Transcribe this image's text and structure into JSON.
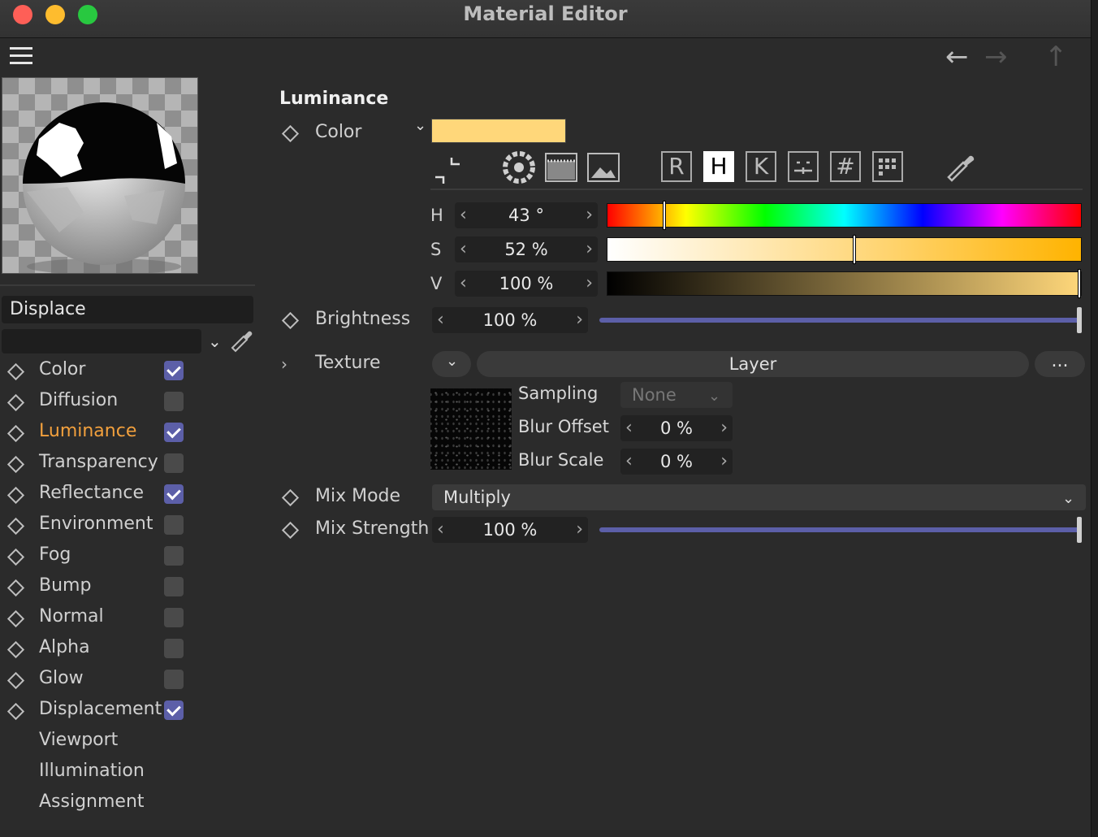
{
  "window": {
    "title": "Material Editor"
  },
  "toolbar": {
    "back_icon": "arrow-left-icon",
    "forward_icon": "arrow-right-icon",
    "up_icon": "arrow-up-icon"
  },
  "material": {
    "name": "Displace",
    "filter_value": ""
  },
  "channels": [
    {
      "label": "Color",
      "checked": true,
      "has_checkbox": true,
      "active": false
    },
    {
      "label": "Diffusion",
      "checked": false,
      "has_checkbox": true,
      "active": false
    },
    {
      "label": "Luminance",
      "checked": true,
      "has_checkbox": true,
      "active": true
    },
    {
      "label": "Transparency",
      "checked": false,
      "has_checkbox": true,
      "active": false
    },
    {
      "label": "Reflectance",
      "checked": true,
      "has_checkbox": true,
      "active": false
    },
    {
      "label": "Environment",
      "checked": false,
      "has_checkbox": true,
      "active": false
    },
    {
      "label": "Fog",
      "checked": false,
      "has_checkbox": true,
      "active": false
    },
    {
      "label": "Bump",
      "checked": false,
      "has_checkbox": true,
      "active": false
    },
    {
      "label": "Normal",
      "checked": false,
      "has_checkbox": true,
      "active": false
    },
    {
      "label": "Alpha",
      "checked": false,
      "has_checkbox": true,
      "active": false
    },
    {
      "label": "Glow",
      "checked": false,
      "has_checkbox": true,
      "active": false
    },
    {
      "label": "Displacement",
      "checked": true,
      "has_checkbox": true,
      "active": false
    },
    {
      "label": "Viewport",
      "has_checkbox": false,
      "active": false
    },
    {
      "label": "Illumination",
      "has_checkbox": false,
      "active": false
    },
    {
      "label": "Assignment",
      "has_checkbox": false,
      "active": false
    }
  ],
  "luminance": {
    "section_title": "Luminance",
    "color_label": "Color",
    "color_value": "#ffd77a",
    "mode_buttons": [
      "R",
      "H",
      "K"
    ],
    "selected_mode": "H",
    "hsv": {
      "h_label": "H",
      "h_value": "43 °",
      "h_fraction": 0.12,
      "s_label": "S",
      "s_value": "52 %",
      "s_fraction": 0.52,
      "v_label": "V",
      "v_value": "100 %",
      "v_fraction": 1.0
    },
    "brightness_label": "Brightness",
    "brightness_value": "100 %",
    "brightness_fraction": 1.0,
    "texture_label": "Texture",
    "layer_label": "Layer",
    "more_label": "...",
    "sampling_label": "Sampling",
    "sampling_value": "None",
    "blur_offset_label": "Blur Offset",
    "blur_offset_value": "0 %",
    "blur_scale_label": "Blur Scale",
    "blur_scale_value": "0 %",
    "mix_mode_label": "Mix Mode",
    "mix_mode_value": "Multiply",
    "mix_strength_label": "Mix Strength",
    "mix_strength_value": "100 %",
    "mix_strength_fraction": 1.0
  },
  "colors": {
    "accent": "#5c5fa8",
    "active_channel": "#f2a03d",
    "swatch": "#ffd77a"
  }
}
